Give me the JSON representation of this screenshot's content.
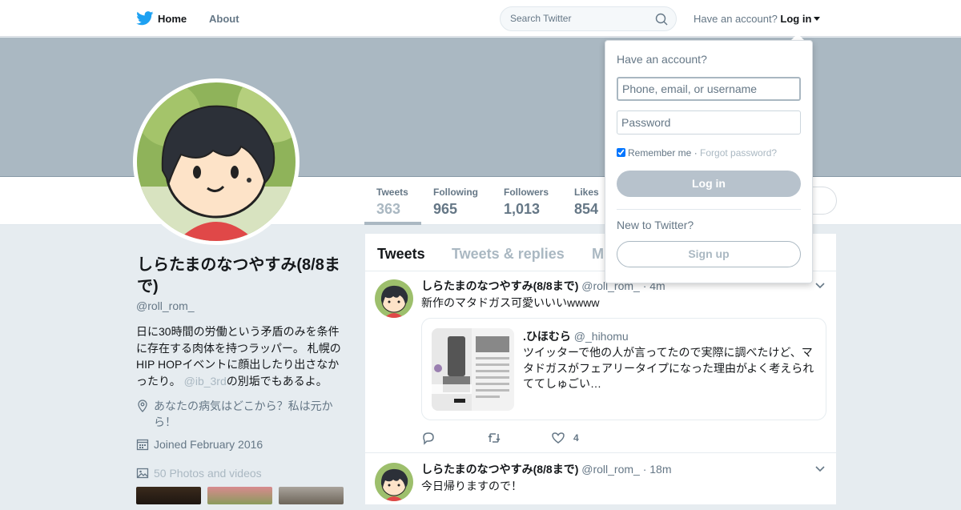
{
  "topbar": {
    "logo_icon": "twitter-bird-icon",
    "home_label": "Home",
    "about_label": "About",
    "search_placeholder": "Search Twitter",
    "have_account_text": "Have an account?",
    "login_label": "Log in",
    "accent_color": "#1da1f2"
  },
  "profile": {
    "name": "しらたまのなつやすみ(8/8まで)",
    "handle": "@roll_rom_",
    "bio_text": "日に30時間の労働という矛盾のみを条件に存在する肉体を持つラッパー。 札幌のHIP HOPイベントに顔出したり出さなかったり。",
    "bio_mention": "@ib_3rd",
    "bio_suffix": "の別垢でもあるよ。",
    "location": "あなたの病気はどこから？私は元から！",
    "joined": "Joined February 2016",
    "photos_label": "50 Photos and videos"
  },
  "stats": [
    {
      "label": "Tweets",
      "value": "363"
    },
    {
      "label": "Following",
      "value": "965"
    },
    {
      "label": "Followers",
      "value": "1,013"
    },
    {
      "label": "Likes",
      "value": "854"
    }
  ],
  "tabs": [
    {
      "label": "Tweets"
    },
    {
      "label": "Tweets & replies"
    },
    {
      "label": "M"
    }
  ],
  "tweets": [
    {
      "name": "しらたまのなつやすみ(8/8まで)",
      "handle_time": "@roll_rom_ · 4m",
      "text": "新作のマタドガス可愛いいいwwww",
      "quote": {
        "name": ".ひほむら",
        "handle": "@_hihomu",
        "text": "ツイッターで他の人が言ってたので実際に調べたけど、マタドガスがフェアリータイプになった理由がよく考えられててしゅごい…"
      },
      "like_count": "4"
    },
    {
      "name": "しらたまのなつやすみ(8/8まで)",
      "handle_time": "@roll_rom_ · 18m",
      "text": "今日帰りますので！"
    }
  ],
  "login_dropdown": {
    "title": "Have an account?",
    "username_placeholder": "Phone, email, or username",
    "password_placeholder": "Password",
    "remember_label": "Remember me",
    "separator": " · ",
    "forgot_label": "Forgot password?",
    "login_button": "Log in",
    "new_label": "New to Twitter?",
    "signup_button": "Sign up"
  }
}
